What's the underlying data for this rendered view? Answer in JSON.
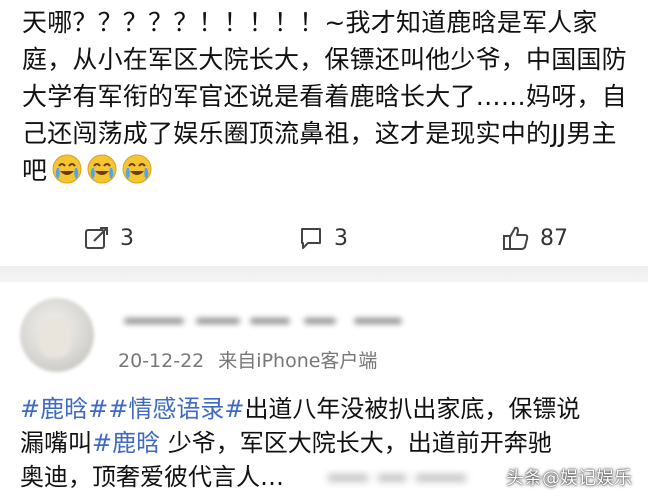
{
  "post1": {
    "text_prefix": "天哪？？？？？！！！！！~我才知道鹿晗是军人家庭，从小在军区大院长大，保镖还叫他少爷，中国国防大学有军衔的军官还说是看着鹿晗长大了……妈呀，自己还闯荡成了娱乐圈顶流鼻祖，这才是现实中的JJ男主吧",
    "emoji_icon": "laughing-crying-emoji",
    "actions": {
      "repost_count": "3",
      "comment_count": "3",
      "like_count": "87"
    }
  },
  "post2": {
    "date": "20-12-22",
    "source": "来自iPhone客户端",
    "text_line1_prefix": "#鹿晗##情感语录#",
    "text_line1_rest": "出道八年没被扒出家底，保镖说",
    "text_line2_prefix": "漏嘴叫",
    "text_line2_tag": "#鹿晗",
    "text_line2_rest": " 少爷，军区大院长大，出道前开奔驰",
    "text_line3": "奥迪，顶奢爱彼代言人…",
    "hashtag_color": "#3f6ac4"
  },
  "watermark": {
    "text": "头条@娱记娱乐"
  }
}
